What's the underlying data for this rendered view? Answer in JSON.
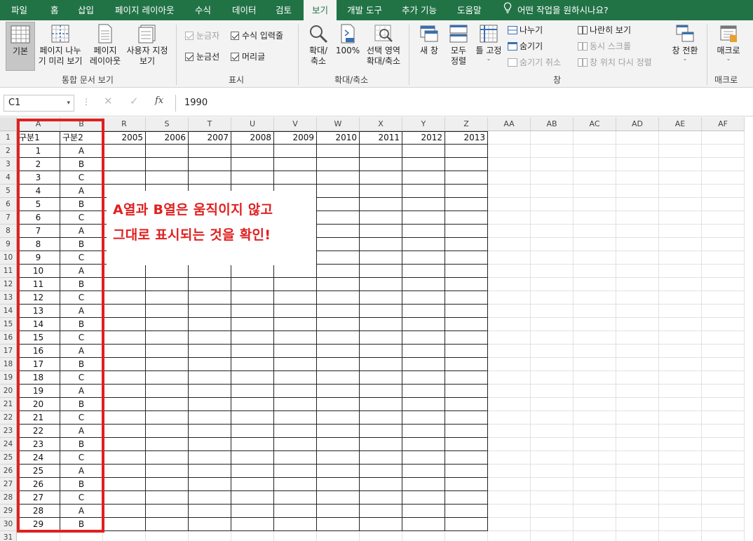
{
  "tabs": [
    "파일",
    "홈",
    "삽입",
    "페이지 레이아웃",
    "수식",
    "데이터",
    "검토",
    "보기",
    "개발 도구",
    "추가 기능",
    "도움말"
  ],
  "active_tab": "보기",
  "tell_me": "어떤 작업을 원하시나요?",
  "ribbon": {
    "workbook_views": {
      "label": "통합 문서 보기",
      "normal": "기본",
      "page_break_1": "페이지 나누",
      "page_break_2": "기 미리 보기",
      "page_layout_1": "페이지",
      "page_layout_2": "레이아웃",
      "custom_1": "사용자 지정",
      "custom_2": "보기"
    },
    "show": {
      "label": "표시",
      "ruler": "눈금자",
      "formula_bar": "수식 입력줄",
      "gridlines": "눈금선",
      "headings": "머리글"
    },
    "zoom": {
      "label": "확대/축소",
      "zoom_1": "확대/",
      "zoom_2": "축소",
      "hundred": "100%",
      "selection_1": "선택 영역",
      "selection_2": "확대/축소"
    },
    "window": {
      "label": "창",
      "new_window": "새 창",
      "arrange_1": "모두",
      "arrange_2": "정렬",
      "freeze": "틀 고정",
      "split": "나누기",
      "hide": "숨기기",
      "unhide": "숨기기 취소",
      "side_by_side": "나란히 보기",
      "sync_scroll": "동시 스크롤",
      "reset_pos": "창 위치 다시 정렬",
      "switch": "창 전환"
    },
    "macros": {
      "label": "매크로",
      "macro": "매크로"
    }
  },
  "formula_bar": {
    "name_box": "C1",
    "fx": "fx",
    "value": "1990"
  },
  "columns": [
    "A",
    "B",
    "R",
    "S",
    "T",
    "U",
    "V",
    "W",
    "X",
    "Y",
    "Z",
    "AA",
    "AB",
    "AC",
    "AD",
    "AE",
    "AF"
  ],
  "header_row": [
    "구분1",
    "구분2",
    "2005",
    "2006",
    "2007",
    "2008",
    "2009",
    "2010",
    "2011",
    "2012",
    "2013"
  ],
  "rows": [
    [
      "1",
      "A"
    ],
    [
      "2",
      "B"
    ],
    [
      "3",
      "C"
    ],
    [
      "4",
      "A"
    ],
    [
      "5",
      "B"
    ],
    [
      "6",
      "C"
    ],
    [
      "7",
      "A"
    ],
    [
      "8",
      "B"
    ],
    [
      "9",
      "C"
    ],
    [
      "10",
      "A"
    ],
    [
      "11",
      "B"
    ],
    [
      "12",
      "C"
    ],
    [
      "13",
      "A"
    ],
    [
      "14",
      "B"
    ],
    [
      "15",
      "C"
    ],
    [
      "16",
      "A"
    ],
    [
      "17",
      "B"
    ],
    [
      "18",
      "C"
    ],
    [
      "19",
      "A"
    ],
    [
      "20",
      "B"
    ],
    [
      "21",
      "C"
    ],
    [
      "22",
      "A"
    ],
    [
      "23",
      "B"
    ],
    [
      "24",
      "C"
    ],
    [
      "25",
      "A"
    ],
    [
      "26",
      "B"
    ],
    [
      "27",
      "C"
    ],
    [
      "28",
      "A"
    ],
    [
      "29",
      "B"
    ]
  ],
  "row_numbers": [
    "1",
    "2",
    "3",
    "4",
    "5",
    "6",
    "7",
    "8",
    "9",
    "10",
    "11",
    "12",
    "13",
    "14",
    "15",
    "16",
    "17",
    "18",
    "19",
    "20",
    "21",
    "22",
    "23",
    "24",
    "25",
    "26",
    "27",
    "28",
    "29",
    "30",
    "31"
  ],
  "annotation": {
    "line1": "A열과 B열은 움직이지 않고",
    "line2": "그대로 표시되는 것을 확인!"
  }
}
